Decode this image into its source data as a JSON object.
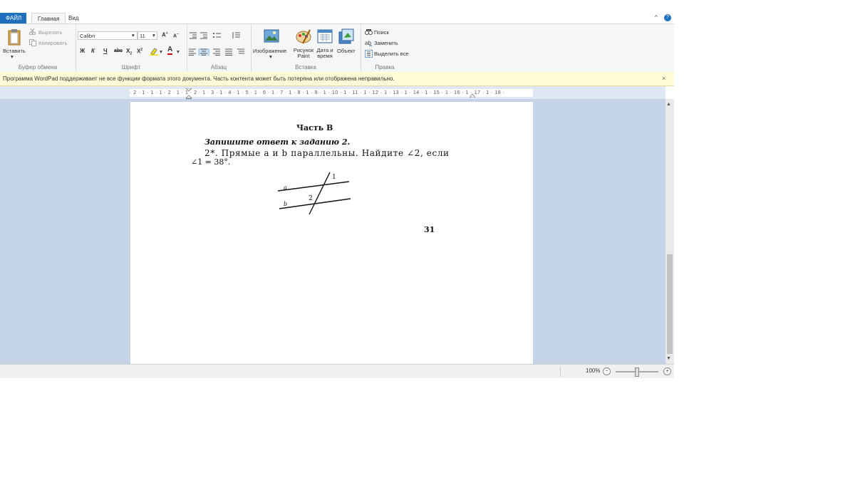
{
  "tabs": {
    "file": "ФАЙЛ",
    "home": "Главная",
    "view": "Вид"
  },
  "ribbon": {
    "clipboard": {
      "paste": "Вставить",
      "cut": "Вырезать",
      "copy": "Копировать",
      "label": "Буфер обмена"
    },
    "font": {
      "family": "Calibri",
      "size": "11",
      "label": "Шрифт",
      "bold": "Ж",
      "italic": "К",
      "underline": "Ч",
      "strike": "abc"
    },
    "paragraph": {
      "label": "Абзац"
    },
    "insert": {
      "picture": "Изображение",
      "paint": "Рисунок Paint",
      "datetime": "Дата и время",
      "object": "Объект",
      "label": "Вставка"
    },
    "editing": {
      "find": "Поиск",
      "replace": "Заменить",
      "selectall": "Выделить все",
      "label": "Правка"
    }
  },
  "infobar": {
    "message": "Программа WordPad поддерживает не все функции формата этого документа. Часть контента может быть потеряна или отображена неправильно."
  },
  "ruler": {
    "text": "· 2 · 1 · 1 · 1 · 2 · 1 · 1 · 2 · 1 · 3 · 1 · 4 · 1 · 5 · 1 · 6 · 1 · 7 · 1 · 8 · 1 · 9 · 1 · 10 · 1 · 11 · 1 · 12 · 1 · 13 · 1 · 14 · 1 · 15 · 1 · 16 · 1 · 17 · 1 · 18 ·"
  },
  "document": {
    "heading": "Часть В",
    "instruction": "Запишите ответ к заданию 2.",
    "task_line1": "2*. Прямые a и b параллельны. Найдите ∠2, если",
    "task_line2": "∠1 = 38°.",
    "labels": {
      "a": "a",
      "b": "b",
      "one": "1",
      "two": "2"
    },
    "page_number": "31"
  },
  "status": {
    "zoom": "100%",
    "zoom_out": "−",
    "zoom_in": "+"
  },
  "colors": {
    "accent": "#1e6fbd",
    "docbg": "#c4d3e7",
    "infobar": "#fffbd6"
  }
}
